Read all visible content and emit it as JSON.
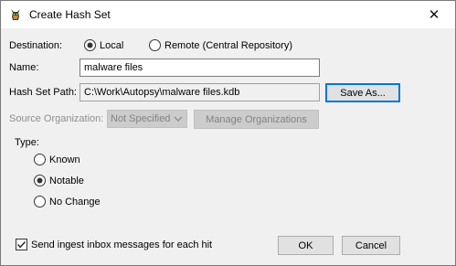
{
  "window": {
    "title": "Create Hash Set",
    "close_glyph": "✕",
    "app_icon": "autopsy-dog-icon"
  },
  "destination": {
    "label": "Destination:",
    "options": [
      {
        "label": "Local",
        "selected": true
      },
      {
        "label": "Remote (Central Repository)",
        "selected": false
      }
    ]
  },
  "name": {
    "label": "Name:",
    "value": "malware files"
  },
  "hash_set_path": {
    "label": "Hash Set Path:",
    "value": "C:\\Work\\Autopsy\\malware files.kdb",
    "save_as_label": "Save As..."
  },
  "source_org": {
    "label": "Source Organization:",
    "selected": "Not Specified",
    "manage_label": "Manage Organizations",
    "enabled": false
  },
  "type": {
    "label": "Type:",
    "options": [
      {
        "label": "Known",
        "selected": false
      },
      {
        "label": "Notable",
        "selected": true
      },
      {
        "label": "No Change",
        "selected": false
      }
    ]
  },
  "ingest_messages": {
    "label": "Send ingest inbox messages for each hit",
    "checked": true
  },
  "buttons": {
    "ok": "OK",
    "cancel": "Cancel"
  },
  "colors": {
    "focus_border": "#0078d7",
    "disabled_text": "#8e8e8e"
  }
}
